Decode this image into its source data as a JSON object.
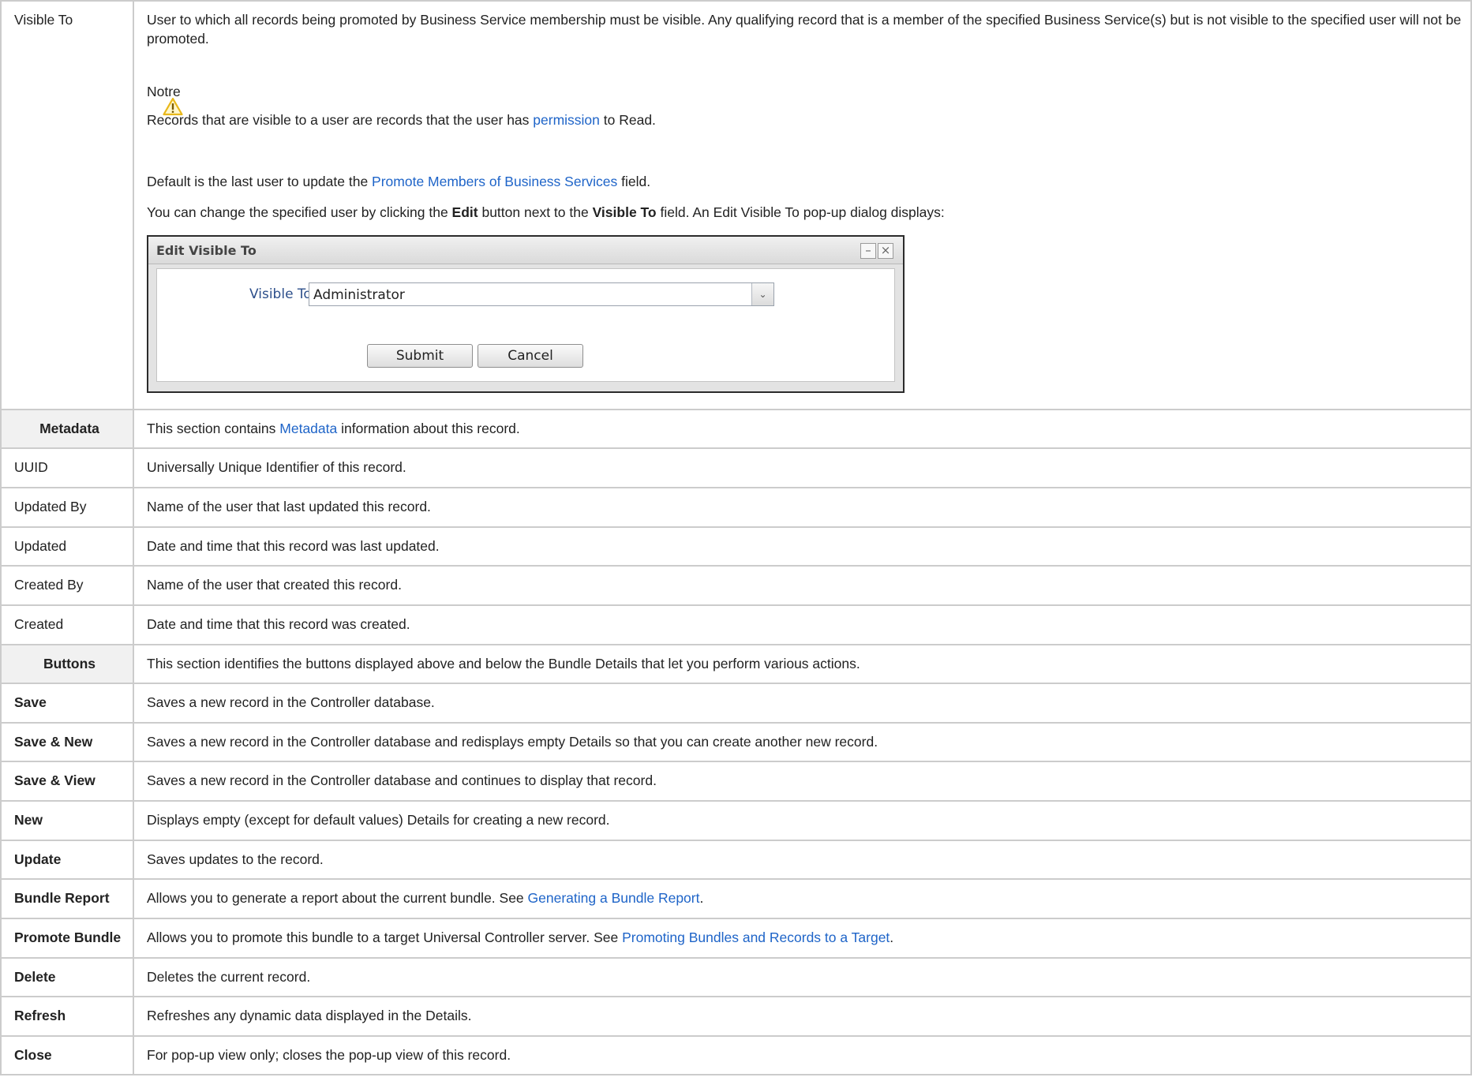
{
  "visible_to": {
    "label": "Visible To",
    "desc": "User to which all records being promoted by Business Service membership must be visible. Any qualifying record that is a member of the specified Business Service(s) but is not visible to the specified user will not be promoted.",
    "note_title": "Notre",
    "note_pre": "Records that are visible to a user are records that the user has ",
    "note_link": "permission",
    "note_post": " to Read.",
    "default_pre": "Default is the last user to update the ",
    "default_link": "Promote Members of Business Services",
    "default_post": " field.",
    "change_1": "You can change the specified user by clicking the ",
    "change_bold1": "Edit",
    "change_2": " button next to the ",
    "change_bold2": "Visible To",
    "change_3": " field. An Edit Visible To pop-up dialog displays:"
  },
  "dialog": {
    "title": "Edit Visible To",
    "field_label": "Visible To :",
    "field_value": "Administrator",
    "submit": "Submit",
    "cancel": "Cancel",
    "minimize_glyph": "–",
    "close_glyph": "×",
    "arrow_glyph": "⌄"
  },
  "metadata": {
    "header": "Metadata",
    "desc_pre": "This section contains ",
    "desc_link": "Metadata",
    "desc_post": " information about this record."
  },
  "meta_rows": [
    {
      "name": "UUID",
      "desc": "Universally Unique Identifier of this record."
    },
    {
      "name": "Updated By",
      "desc": "Name of the user that last updated this record."
    },
    {
      "name": "Updated",
      "desc": "Date and time that this record was last updated."
    },
    {
      "name": "Created By",
      "desc": "Name of the user that created this record."
    },
    {
      "name": "Created",
      "desc": "Date and time that this record was created."
    }
  ],
  "buttons": {
    "header": "Buttons",
    "desc": "This section identifies the buttons displayed above and below the Bundle Details that let you perform various actions."
  },
  "button_rows": [
    {
      "name": "Save",
      "desc": "Saves a new record in the Controller database."
    },
    {
      "name": "Save & New",
      "desc": "Saves a new record in the Controller database and redisplays empty Details so that you can create another new record."
    },
    {
      "name": "Save & View",
      "desc": "Saves a new record in the Controller database and continues to display that record."
    },
    {
      "name": "New",
      "desc": "Displays empty (except for default values) Details for creating a new record."
    },
    {
      "name": "Update",
      "desc": "Saves updates to the record."
    },
    {
      "name": "Bundle Report",
      "desc_pre": "Allows you to generate a report about the current bundle. See ",
      "desc_link": "Generating a Bundle Report",
      "desc_post": "."
    },
    {
      "name": "Promote Bundle",
      "desc_pre": "Allows you to promote this bundle to a target Universal Controller server. See ",
      "desc_link": "Promoting Bundles and Records to a Target",
      "desc_post": "."
    },
    {
      "name": "Delete",
      "desc": "Deletes the current record."
    },
    {
      "name": "Refresh",
      "desc": "Refreshes any dynamic data displayed in the Details."
    },
    {
      "name": "Close",
      "desc": "For pop-up view only; closes the pop-up view of this record."
    }
  ],
  "colors": {
    "link": "#1e64c8",
    "header_bg": "#f1f1f1",
    "border": "#cccccc",
    "dialog_label": "#2d4f8b"
  },
  "icons": {
    "warning": "warning-icon"
  }
}
